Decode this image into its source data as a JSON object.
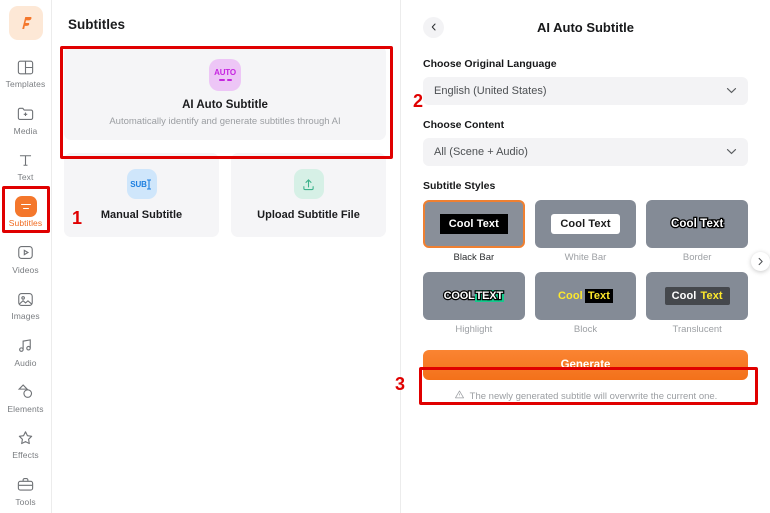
{
  "sidebar": {
    "logo_label": "F",
    "items": [
      {
        "label": "Templates",
        "icon": "templates-icon",
        "active": false
      },
      {
        "label": "Media",
        "icon": "media-icon",
        "active": false
      },
      {
        "label": "Text",
        "icon": "text-icon",
        "active": false
      },
      {
        "label": "Subtitles",
        "icon": "subtitles-icon",
        "active": true
      },
      {
        "label": "Videos",
        "icon": "videos-icon",
        "active": false
      },
      {
        "label": "Images",
        "icon": "images-icon",
        "active": false
      },
      {
        "label": "Audio",
        "icon": "audio-icon",
        "active": false
      },
      {
        "label": "Elements",
        "icon": "elements-icon",
        "active": false
      },
      {
        "label": "Effects",
        "icon": "effects-icon",
        "active": false
      },
      {
        "label": "Tools",
        "icon": "tools-icon",
        "active": false
      }
    ]
  },
  "middle": {
    "title": "Subtitles",
    "ai_card": {
      "icon_text": "AUTO",
      "title": "AI Auto Subtitle",
      "description": "Automatically identify and generate subtitles through AI"
    },
    "options": [
      {
        "icon_text": "SUB",
        "title": "Manual Subtitle"
      },
      {
        "icon_text": "upload-icon",
        "title": "Upload Subtitle File"
      }
    ]
  },
  "right": {
    "back_icon": "chevron-left-icon",
    "title": "AI Auto Subtitle",
    "language_label": "Choose Original Language",
    "language_value": "English (United States)",
    "content_label": "Choose Content",
    "content_value": "All (Scene + Audio)",
    "styles_label": "Subtitle Styles",
    "styles": [
      {
        "name": "Black Bar",
        "preview": "Cool Text",
        "selected": true
      },
      {
        "name": "White Bar",
        "preview": "Cool Text",
        "selected": false
      },
      {
        "name": "Border",
        "preview": "Cool Text",
        "selected": false
      },
      {
        "name": "Highlight",
        "preview_1": "COOL",
        "preview_2": "TEXT",
        "selected": false
      },
      {
        "name": "Block",
        "preview_1": "Cool",
        "preview_2": "Text",
        "selected": false
      },
      {
        "name": "Translucent",
        "preview_1": "Cool",
        "preview_2": "Text",
        "selected": false
      }
    ],
    "carousel_next_icon": "chevron-right-icon",
    "generate_label": "Generate",
    "note_icon": "warning-triangle-icon",
    "note_text": "The newly generated subtitle will overwrite the current one."
  },
  "annotations": {
    "step_1": "1",
    "step_2": "2",
    "step_3": "3",
    "highlight_color": "#e00000"
  },
  "colors": {
    "accent": "#f4772c",
    "generate": "#f3711a",
    "panel_bg": "#f5f5f7",
    "thumb_bg": "#848b96"
  }
}
